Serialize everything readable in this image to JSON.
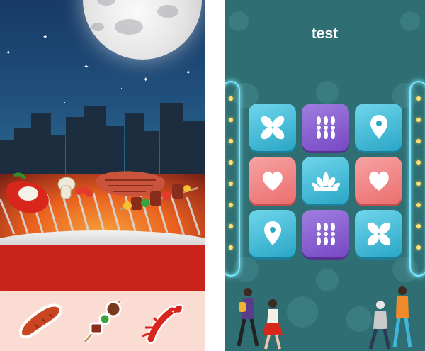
{
  "board": {
    "title": "test",
    "tiles": [
      {
        "icon": "propeller-icon",
        "color": "blue"
      },
      {
        "icon": "chain-icon",
        "color": "purple"
      },
      {
        "icon": "map-pin-icon",
        "color": "blue"
      },
      {
        "icon": "heart-icon",
        "color": "pink"
      },
      {
        "icon": "fan-shell-icon",
        "color": "blue"
      },
      {
        "icon": "heart-icon",
        "color": "pink"
      },
      {
        "icon": "map-pin-icon",
        "color": "blue"
      },
      {
        "icon": "chain-icon",
        "color": "purple"
      },
      {
        "icon": "propeller-icon",
        "color": "blue"
      }
    ]
  },
  "tray": {
    "items": [
      "sausage-icon",
      "kebab-icon",
      "lobster-icon"
    ]
  },
  "colors": {
    "board_bg": "#2f6f73",
    "tray_bg": "#fadcd3",
    "grill_red": "#c8241c",
    "neon": "#7be8ff"
  }
}
